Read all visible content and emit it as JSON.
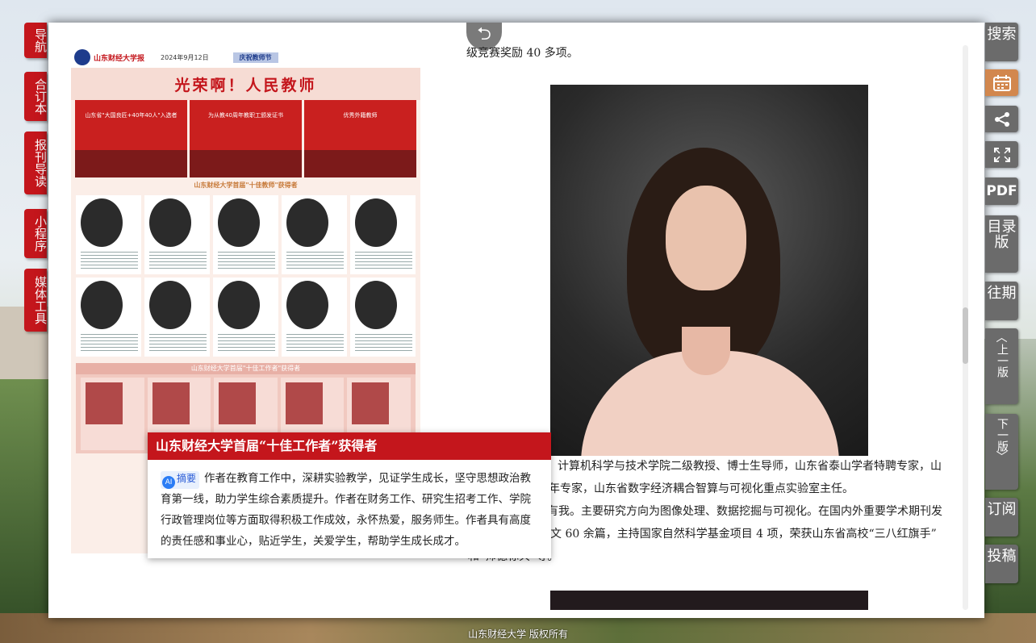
{
  "left_nav": [
    {
      "label": "导航"
    },
    {
      "label": "合订本"
    },
    {
      "label": "报刊导读"
    },
    {
      "label": "小程序"
    },
    {
      "label": "媒体工具"
    }
  ],
  "right_nav": {
    "search": "搜索",
    "calendar_icon": "calendar-icon",
    "share_icon": "share-icon",
    "fullscreen_icon": "fullscreen-icon",
    "pdf": "PDF",
    "catalog": "目录版",
    "archive": "往期",
    "prev": "上一版",
    "next": "下一版",
    "subscribe": "订阅",
    "submit": "投稿"
  },
  "back_icon": "back-arrow-icon",
  "newspaper": {
    "masthead": "山东财经大学报",
    "date": "2024年9月12日",
    "section": "庆祝教师节",
    "banner": "光荣啊！人民教师",
    "photos": [
      {
        "caption": "山东省\"大国良匠+40年40人\"入选者"
      },
      {
        "caption": "为从教40周年教职工颁发证书"
      },
      {
        "caption": "优秀外籍教师"
      }
    ],
    "section1": "山东财经大学首届\"十佳教师\"获得者",
    "section2": "山东财经大学首届\"十佳工作者\"获得者"
  },
  "article": {
    "line_top": "级竞赛奖励 40 多项。",
    "bio_lines": [
      "计算机科学与技术学院二级教授、博士生导师，山东省泰山学者特聘专家，山",
      "中青年专家，山东省数字经济耦合智算与可视化重点实验室主任。",
      "有我。主要研究方向为图像处理、数据挖掘与可视化。在国内外重要学术期刊发",
      "文 60 余篇，主持国家自然科学基金项目 4 项，荣获山东省高校“三八红旗手”",
      "和“师德标兵”等。"
    ]
  },
  "popup": {
    "title": "山东财经大学首届“十佳工作者”获得者",
    "ai_badge": "AI",
    "summary_label": "摘要",
    "summary": "作者在教育工作中，深耕实验教学，见证学生成长，坚守思想政治教育第一线，助力学生综合素质提升。作者在财务工作、研究生招考工作、学院行政管理岗位等方面取得积极工作成效，永怀热爱，服务师生。作者具有高度的责任感和事业心，贴近学生，关爱学生，帮助学生成长成才。"
  },
  "footer": "山东财经大学 版权所有"
}
